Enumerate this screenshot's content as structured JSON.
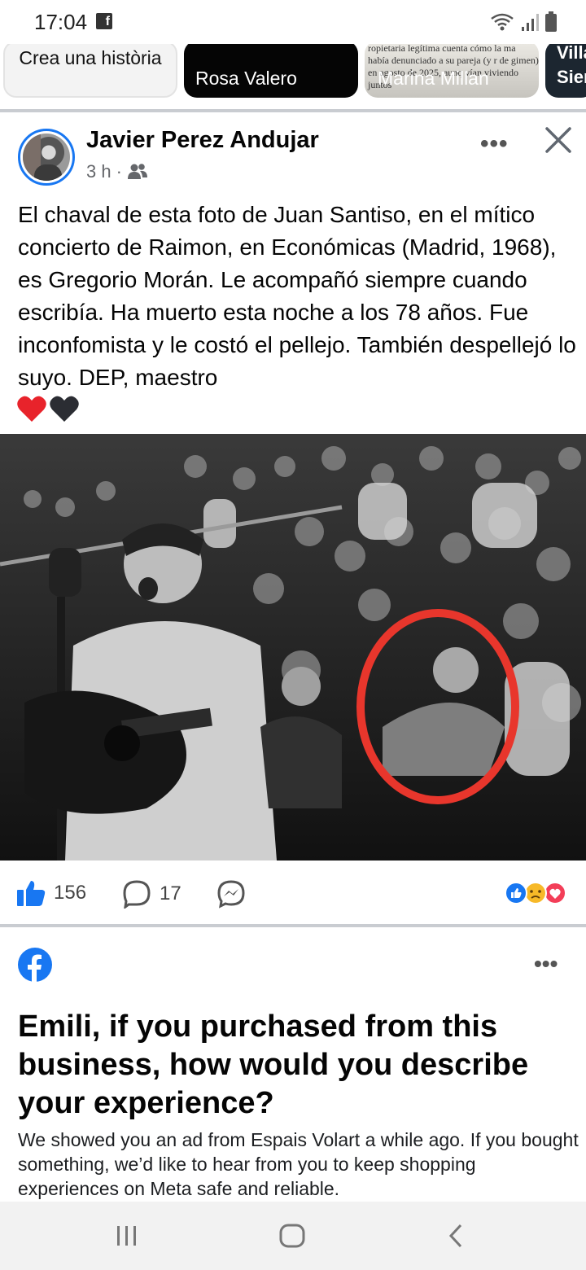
{
  "status_bar": {
    "time": "17:04"
  },
  "stories": [
    {
      "label": "Crea una història"
    },
    {
      "label": "Rosa Valero"
    },
    {
      "label": "Marina Millan",
      "headline": "ropietaria legítima cuenta cómo la ma había denunciado a su pareja (y r de gimen) en agosto de 2025, aunq vían viviendo juntos"
    },
    {
      "label": "Villa Sien"
    }
  ],
  "post": {
    "author": "Javier Perez Andujar",
    "time": "3 h",
    "separator": "·",
    "text": "El chaval de esta foto de Juan Santiso, en el mítico concierto de Raimon, en Económicas (Madrid, 1968), es Gregorio Morán. Le acompañó siempre cuando escribía. Ha muerto esta noche a los 78 años. Fue inconfomista y le costó el pellejo. También despellejó lo suyo. DEP, maestro",
    "emojis": [
      "❤️",
      "🖤"
    ],
    "likes": "156",
    "comments": "17"
  },
  "ad": {
    "title": "Emili, if you purchased from this business, how would you describe your experience?",
    "body": "We showed you an ad from Espais Volart a while ago. If you bought something, we’d like to hear from you to keep shopping experiences on Meta safe and reliable."
  },
  "colors": {
    "brand": "#1877f2",
    "ring_highlight": "#e8362c"
  }
}
